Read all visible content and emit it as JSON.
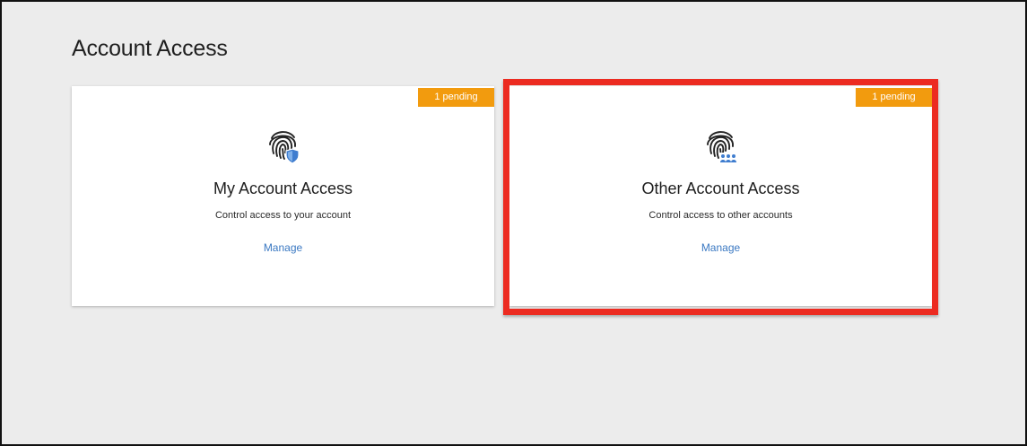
{
  "page": {
    "title": "Account Access"
  },
  "cards": [
    {
      "badge": "1 pending",
      "icon": "fingerprint-shield-icon",
      "title": "My Account Access",
      "description": "Control access to your account",
      "link": "Manage"
    },
    {
      "badge": "1 pending",
      "icon": "fingerprint-people-icon",
      "title": "Other Account Access",
      "description": "Control access to other accounts",
      "link": "Manage"
    }
  ],
  "colors": {
    "background": "#ececec",
    "badge": "#f29b0e",
    "link": "#3a78c2",
    "highlight": "#ec2b21",
    "icon_accent": "#3f7dcf"
  }
}
